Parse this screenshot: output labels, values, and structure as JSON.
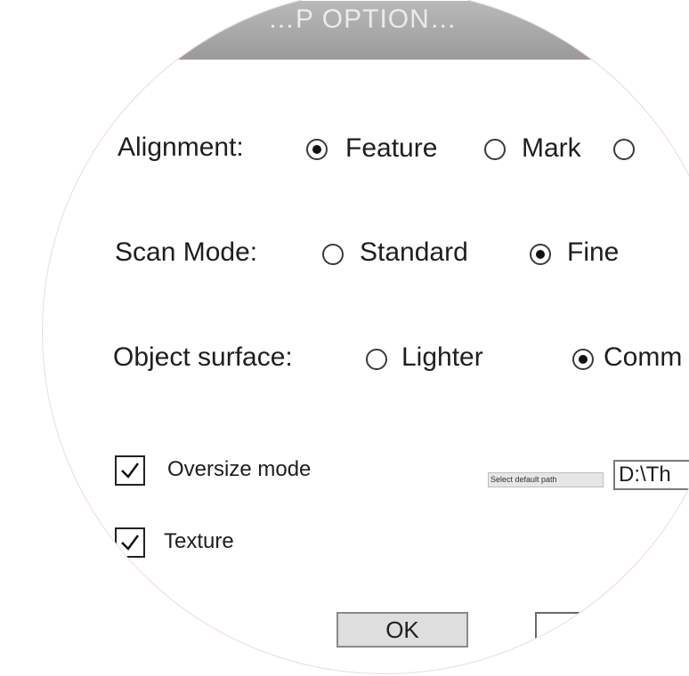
{
  "title_bar": {
    "text": "…P OPTION…"
  },
  "alignment": {
    "label": "Alignment:",
    "options": [
      {
        "label": "Feature",
        "checked": true
      },
      {
        "label": "Mark",
        "checked": false
      },
      {
        "label": "",
        "checked": false
      }
    ]
  },
  "scan_mode": {
    "label": "Scan Mode:",
    "options": [
      {
        "label": "Standard",
        "checked": false
      },
      {
        "label": "Fine",
        "checked": true
      }
    ]
  },
  "object_surface": {
    "label": "Object surface:",
    "options": [
      {
        "label": "Lighter",
        "checked": false
      },
      {
        "label": "Comm",
        "checked": true
      }
    ]
  },
  "oversize_mode": {
    "label": "Oversize mode",
    "checked": true
  },
  "texture": {
    "label": "Texture",
    "checked": true
  },
  "default_path": {
    "button_label": "Select default path",
    "value": "D:\\Th"
  },
  "ok_button": {
    "label": "OK"
  },
  "cancel_button": {
    "label": ""
  },
  "colors": {
    "title_bar": "#a8a8a8",
    "lens_border": "#f0d9dc",
    "button_face": "#dedede"
  }
}
